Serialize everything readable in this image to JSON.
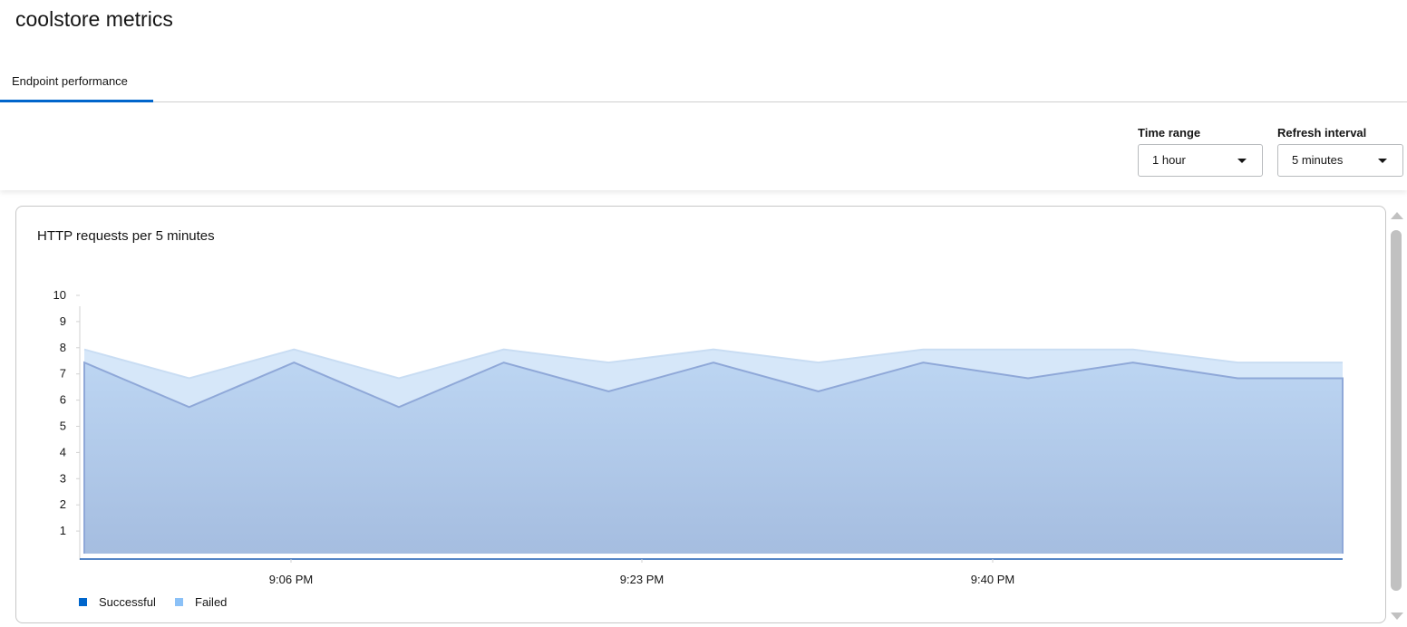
{
  "page": {
    "title": "coolstore metrics"
  },
  "tabs": [
    {
      "label": "Endpoint performance",
      "active": true
    }
  ],
  "filters": {
    "time_range": {
      "label": "Time range",
      "value": "1 hour"
    },
    "refresh_interval": {
      "label": "Refresh interval",
      "value": "5 minutes"
    }
  },
  "colors": {
    "accent": "#0066cc",
    "successful": "#06c",
    "failed": "#8bc1f7"
  },
  "chart_data": {
    "type": "area",
    "title": "HTTP requests per 5 minutes",
    "xlabel": "",
    "ylabel": "",
    "ylim": [
      0,
      10
    ],
    "yticks": [
      "1",
      "2",
      "3",
      "4",
      "5",
      "6",
      "7",
      "8",
      "9",
      "10"
    ],
    "x_tick_labels": [
      "9:06 PM",
      "9:23 PM",
      "9:40 PM"
    ],
    "stacked": true,
    "series": [
      {
        "name": "Successful",
        "values": [
          7.4,
          5.7,
          7.4,
          5.7,
          7.4,
          6.3,
          7.4,
          6.3,
          7.4,
          6.8,
          7.4,
          6.8,
          6.8
        ]
      },
      {
        "name": "Failed",
        "values": [
          0.5,
          1.1,
          0.5,
          1.1,
          0.5,
          1.1,
          0.5,
          1.1,
          0.5,
          1.1,
          0.5,
          0.6,
          0.6
        ]
      }
    ],
    "legend": {
      "position": "bottom-left"
    }
  }
}
